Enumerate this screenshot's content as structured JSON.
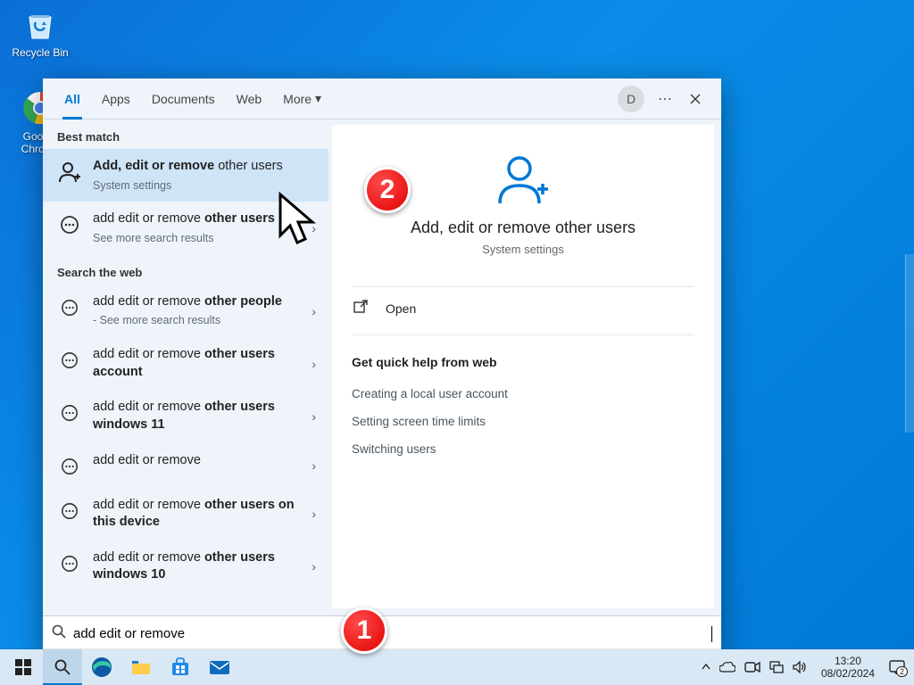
{
  "desktop": {
    "recycle_bin": "Recycle Bin",
    "chrome": "Google Chrome"
  },
  "search": {
    "tabs": [
      "All",
      "Apps",
      "Documents",
      "Web",
      "More"
    ],
    "user_initial": "D",
    "best_match_label": "Best match",
    "best_match": {
      "title_prefix": "Add, edit or remove",
      "title_suffix": " other users",
      "sub": "System settings"
    },
    "see_more": {
      "title_prefix": "add edit or remove ",
      "title_bold": "other users",
      "sub": "See more search results"
    },
    "search_web_label": "Search the web",
    "web_results": [
      {
        "prefix": "add edit or remove ",
        "bold": "other people",
        "sub": "- See more search results"
      },
      {
        "prefix": "add edit or remove ",
        "bold": "other users account",
        "sub": ""
      },
      {
        "prefix": "add edit or remove ",
        "bold": "other users windows 11",
        "sub": ""
      },
      {
        "prefix": "add edit or remove",
        "bold": "",
        "sub": ""
      },
      {
        "prefix": "add edit or remove ",
        "bold": "other users on this device",
        "sub": ""
      },
      {
        "prefix": "add edit or remove ",
        "bold": "other users windows 10",
        "sub": ""
      }
    ],
    "detail": {
      "title": "Add, edit or remove other users",
      "sub": "System settings",
      "open": "Open",
      "quick_title": "Get quick help from web",
      "quick_links": [
        "Creating a local user account",
        "Setting screen time limits",
        "Switching users"
      ]
    },
    "query": "add edit or remove"
  },
  "annotations": {
    "badge1": "1",
    "badge2": "2"
  },
  "taskbar": {
    "time": "13:20",
    "date": "08/02/2024",
    "notif_count": "2"
  }
}
